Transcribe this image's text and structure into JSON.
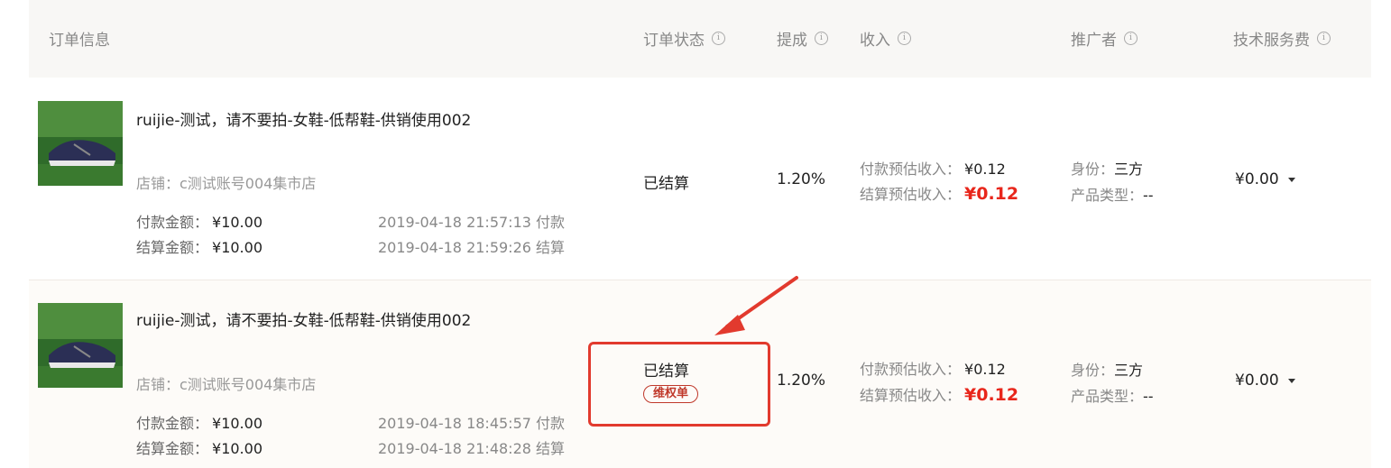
{
  "header": {
    "order_info": "订单信息",
    "order_status": "订单状态",
    "commission": "提成",
    "income": "收入",
    "promoter": "推广者",
    "service_fee": "技术服务费",
    "info_glyph": "i"
  },
  "rows": [
    {
      "title": "ruijie-测试，请不要拍-女鞋-低帮鞋-供销使用002",
      "shop": "店铺：c测试账号004集市店",
      "pay_label": "付款金额：",
      "pay_amount": "¥10.00",
      "settle_label": "结算金额：",
      "settle_amount": "¥10.00",
      "pay_time": "2019-04-18 21:57:13 付款",
      "settle_time": "2019-04-18 21:59:26 结算",
      "status": "已结算",
      "rate": "1.20%",
      "est_pay_label": "付款预估收入：",
      "est_pay_value": "¥0.12",
      "est_settle_label": "结算预估收入：",
      "est_settle_value": "¥0.12",
      "identity_label": "身份：",
      "identity_value": "三方",
      "product_type_label": "产品类型：",
      "product_type_value": "--",
      "fee": "¥0.00"
    },
    {
      "title": "ruijie-测试，请不要拍-女鞋-低帮鞋-供销使用002",
      "shop": "店铺：c测试账号004集市店",
      "pay_label": "付款金额：",
      "pay_amount": "¥10.00",
      "settle_label": "结算金额：",
      "settle_amount": "¥10.00",
      "pay_time": "2019-04-18 18:45:57 付款",
      "settle_time": "2019-04-18 21:48:28 结算",
      "status": "已结算",
      "badge": "维权单",
      "rate": "1.20%",
      "est_pay_label": "付款预估收入：",
      "est_pay_value": "¥0.12",
      "est_settle_label": "结算预估收入：",
      "est_settle_value": "¥0.12",
      "identity_label": "身份：",
      "identity_value": "三方",
      "product_type_label": "产品类型：",
      "product_type_value": "--",
      "fee": "¥0.00"
    }
  ],
  "colors": {
    "accent_red": "#e8261b",
    "highlight_red": "#e23a2e",
    "header_bg": "#f8f7f5"
  },
  "icons": [
    "info-icon",
    "caret-down-icon",
    "annotation-arrow-icon",
    "product-thumbnail-image"
  ]
}
